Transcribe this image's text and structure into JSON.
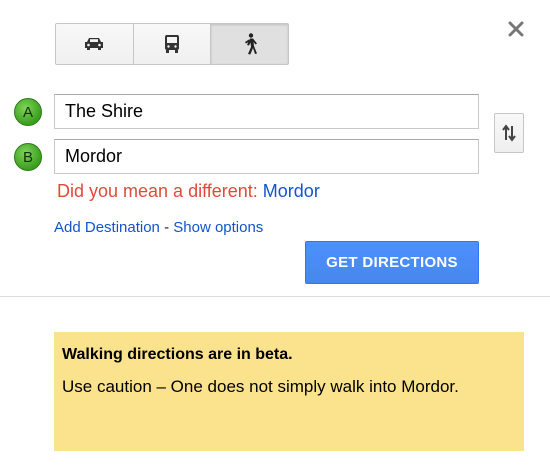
{
  "travel_modes": [
    {
      "name": "car-icon",
      "active": false
    },
    {
      "name": "bus-icon",
      "active": false
    },
    {
      "name": "walking-icon",
      "active": true
    }
  ],
  "waypoints": {
    "a": {
      "marker": "A",
      "value": "The Shire"
    },
    "b": {
      "marker": "B",
      "value": "Mordor"
    }
  },
  "suggestion": {
    "prefix": "Did you mean a different: ",
    "link": "Mordor"
  },
  "links": {
    "add_destination": "Add Destination",
    "separator": " - ",
    "show_options": "Show options"
  },
  "actions": {
    "get_directions": "GET DIRECTIONS"
  },
  "warning": {
    "title": "Walking directions are in beta.",
    "body": "Use caution – One does not simply walk into Mordor."
  },
  "colors": {
    "primary_button": "#4d90fe",
    "warning_bg": "#fbe28c",
    "error_text": "#dd4b39",
    "link": "#1155cc",
    "marker_green": "#3a9e1e"
  }
}
